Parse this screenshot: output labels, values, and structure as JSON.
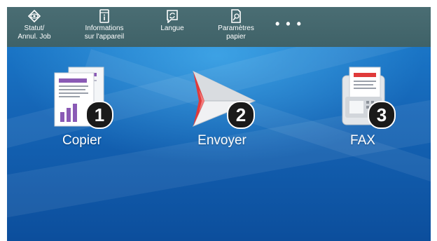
{
  "toolbar": {
    "items": [
      {
        "icon": "eye-icon",
        "line1": "Statut/",
        "line2": "Annul. Job"
      },
      {
        "icon": "device-info-icon",
        "line1": "Informations",
        "line2": "sur l'appareil"
      },
      {
        "icon": "language-icon",
        "line1": "Langue",
        "line2": ""
      },
      {
        "icon": "paper-settings-icon",
        "line1": "Paramètres",
        "line2": "papier"
      }
    ],
    "more_label": "• • •"
  },
  "apps": [
    {
      "label": "Copier",
      "badge": "1",
      "icon": "copier-icon"
    },
    {
      "label": "Envoyer",
      "badge": "2",
      "icon": "send-icon"
    },
    {
      "label": "FAX",
      "badge": "3",
      "icon": "fax-icon"
    }
  ],
  "colors": {
    "toolbar_bg": "#456870",
    "screen_blue": "#1565b6",
    "badge_bg": "#1a1a1a",
    "send_red": "#e03a3a"
  }
}
